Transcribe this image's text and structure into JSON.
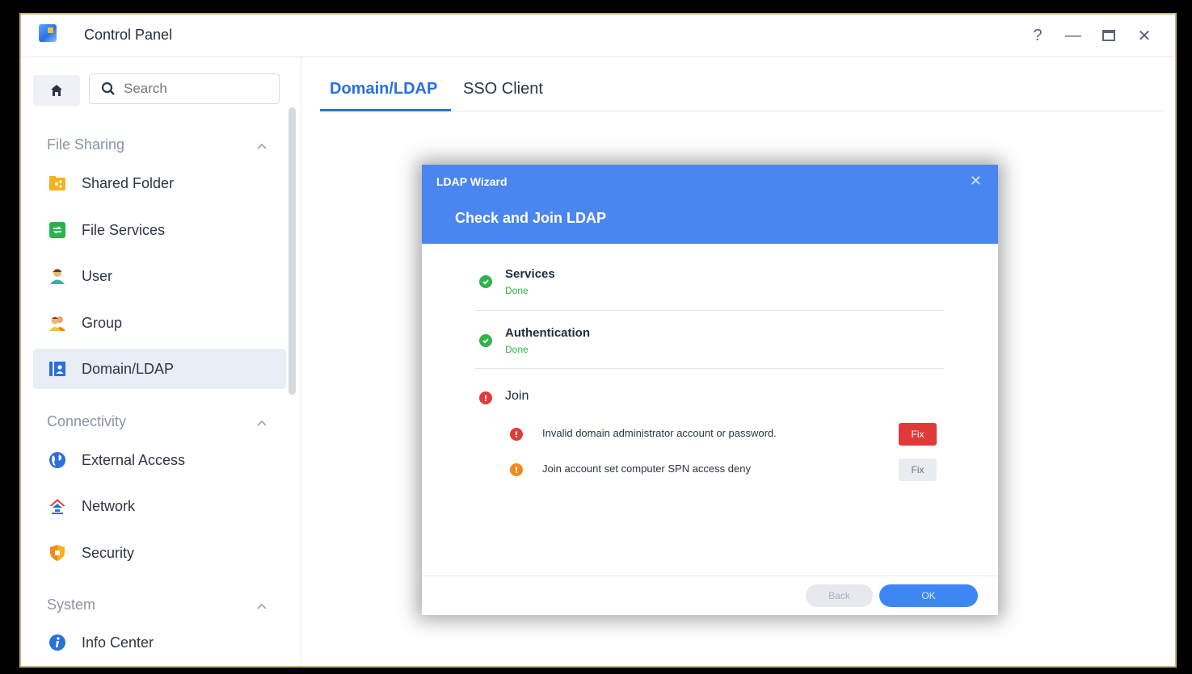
{
  "window": {
    "title": "Control Panel",
    "controls": {
      "help": "?",
      "minimize": "—",
      "maximize": "☐",
      "close": "✕"
    }
  },
  "sidebar": {
    "search_placeholder": "Search",
    "sections": [
      {
        "label": "File Sharing",
        "items": [
          {
            "label": "Shared Folder",
            "icon": "shared-folder-icon"
          },
          {
            "label": "File Services",
            "icon": "file-services-icon"
          },
          {
            "label": "User",
            "icon": "user-icon"
          },
          {
            "label": "Group",
            "icon": "group-icon"
          },
          {
            "label": "Domain/LDAP",
            "icon": "domain-ldap-icon",
            "active": true
          }
        ]
      },
      {
        "label": "Connectivity",
        "items": [
          {
            "label": "External Access",
            "icon": "globe-icon"
          },
          {
            "label": "Network",
            "icon": "network-icon"
          },
          {
            "label": "Security",
            "icon": "shield-icon"
          }
        ]
      },
      {
        "label": "System",
        "items": [
          {
            "label": "Info Center",
            "icon": "info-icon"
          }
        ]
      }
    ]
  },
  "tabs": [
    {
      "label": "Domain/LDAP",
      "active": true
    },
    {
      "label": "SSO Client",
      "active": false
    }
  ],
  "dialog": {
    "title": "LDAP Wizard",
    "close": "✕",
    "heading": "Check and Join LDAP",
    "steps": [
      {
        "name": "Services",
        "status": "Done",
        "state": "success"
      },
      {
        "name": "Authentication",
        "status": "Done",
        "state": "success"
      },
      {
        "name": "Join",
        "state": "error"
      }
    ],
    "issues": [
      {
        "text": "Invalid domain administrator account or password.",
        "severity": "error",
        "fix_label": "Fix"
      },
      {
        "text": "Join account set computer SPN access deny",
        "severity": "warning",
        "fix_label": "Fix"
      }
    ],
    "footer": {
      "back_label": "Back",
      "ok_label": "OK"
    }
  },
  "colors": {
    "accent": "#2a6fde",
    "dialog_header": "#4a86f0",
    "success": "#2fb34a",
    "error": "#e03a3a",
    "warning": "#f08a1c",
    "frame": "#c9b27c"
  }
}
